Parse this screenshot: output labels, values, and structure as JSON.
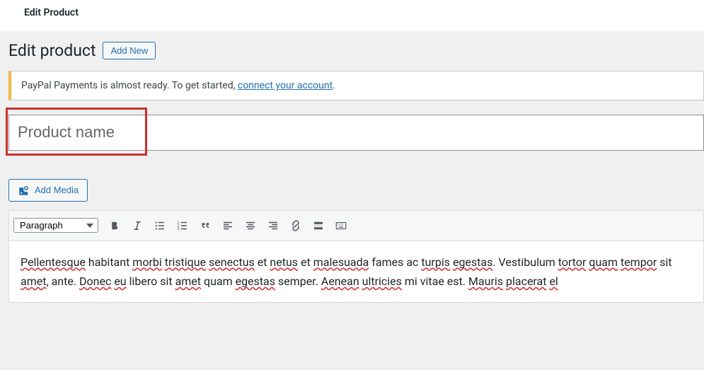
{
  "topbar": {
    "title": "Edit Product"
  },
  "header": {
    "title": "Edit product",
    "add_new": "Add New"
  },
  "notice": {
    "text": "PayPal Payments is almost ready. To get started, ",
    "link": "connect your account",
    "tail": "."
  },
  "title_input": {
    "placeholder": "Product name",
    "value": ""
  },
  "editor": {
    "add_media": "Add Media",
    "format": "Paragraph",
    "body_words": [
      {
        "t": "Pellentesque",
        "w": true
      },
      {
        "t": " "
      },
      {
        "t": "habitant",
        "w": false
      },
      {
        "t": " "
      },
      {
        "t": "morbi",
        "w": true
      },
      {
        "t": " "
      },
      {
        "t": "tristique",
        "w": true
      },
      {
        "t": " "
      },
      {
        "t": "senectus",
        "w": true
      },
      {
        "t": " et "
      },
      {
        "t": "netus",
        "w": true
      },
      {
        "t": " et "
      },
      {
        "t": "malesuada",
        "w": true
      },
      {
        "t": " "
      },
      {
        "t": "fames",
        "w": false
      },
      {
        "t": " ac "
      },
      {
        "t": "turpis",
        "w": true
      },
      {
        "t": " "
      },
      {
        "t": "egestas",
        "w": true
      },
      {
        "t": ". Vestibulum "
      },
      {
        "t": "tortor",
        "w": true
      },
      {
        "t": " "
      },
      {
        "t": "quam",
        "w": true
      },
      {
        "t": " "
      },
      {
        "t": "tempor",
        "w": true
      },
      {
        "t": " sit "
      },
      {
        "t": "amet",
        "w": true
      },
      {
        "t": ", ante. "
      },
      {
        "t": "Donec",
        "w": true
      },
      {
        "t": " "
      },
      {
        "t": "eu",
        "w": true
      },
      {
        "t": " libero sit "
      },
      {
        "t": "amet",
        "w": true
      },
      {
        "t": " quam "
      },
      {
        "t": "egestas",
        "w": true
      },
      {
        "t": " semper. "
      },
      {
        "t": "Aenean",
        "w": true
      },
      {
        "t": " "
      },
      {
        "t": "ultricies",
        "w": true
      },
      {
        "t": " mi vitae est. "
      },
      {
        "t": "Mauris",
        "w": true
      },
      {
        "t": " "
      },
      {
        "t": "placerat",
        "w": true
      },
      {
        "t": " "
      },
      {
        "t": "el",
        "w": true
      }
    ]
  }
}
